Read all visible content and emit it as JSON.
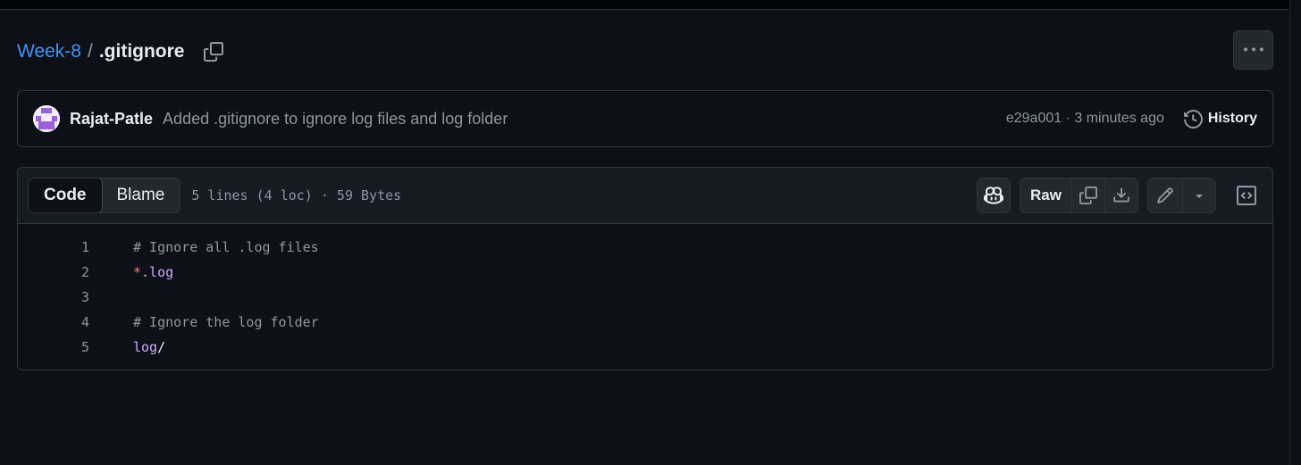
{
  "breadcrumb": {
    "repo": "Week-8",
    "separator": "/",
    "file": ".gitignore",
    "copy_icon": "copy-icon"
  },
  "header": {
    "more_icon": "kebab-horizontal-icon"
  },
  "commit": {
    "author": "Rajat-Patle",
    "message": "Added .gitignore to ignore log files and log folder",
    "sha_time": "e29a001 · 3 minutes ago",
    "history_label": "History",
    "history_icon": "history-icon"
  },
  "file": {
    "tabs": [
      {
        "label": "Code",
        "active": true
      },
      {
        "label": "Blame",
        "active": false
      }
    ],
    "info": "5 lines (4 loc) · 59 Bytes",
    "toolbar": {
      "copilot_icon": "copilot-icon",
      "raw_label": "Raw",
      "copy_icon": "copy-icon",
      "download_icon": "download-icon",
      "edit_icon": "pencil-icon",
      "edit_dropdown_icon": "triangle-down-icon",
      "symbols_icon": "code-square-icon"
    },
    "lines": [
      {
        "num": "1",
        "parts": [
          {
            "t": "# Ignore all .log files",
            "k": "comment"
          }
        ]
      },
      {
        "num": "2",
        "parts": [
          {
            "t": "*",
            "k": "star"
          },
          {
            "t": ".log",
            "k": "name"
          }
        ]
      },
      {
        "num": "3",
        "parts": []
      },
      {
        "num": "4",
        "parts": [
          {
            "t": "# Ignore the log folder",
            "k": "comment"
          }
        ]
      },
      {
        "num": "5",
        "parts": [
          {
            "t": "log",
            "k": "name"
          },
          {
            "t": "/",
            "k": "plain"
          }
        ]
      }
    ]
  },
  "colors": {
    "background": "#0d1117",
    "link": "#4493f8",
    "border": "#30363d",
    "muted": "#8d96a0",
    "comment": "#9198a1",
    "keyword": "#ff7b72",
    "entity": "#d2a8ff"
  }
}
